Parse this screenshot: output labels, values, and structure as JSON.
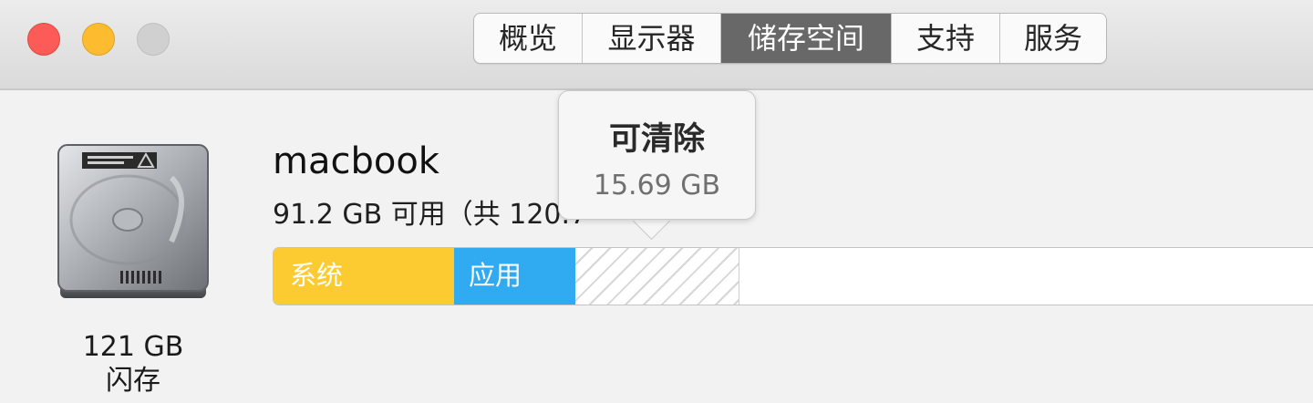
{
  "window": {
    "controls": [
      "close",
      "minimize",
      "zoom"
    ],
    "tabs": [
      {
        "label": "概览",
        "active": false
      },
      {
        "label": "显示器",
        "active": false
      },
      {
        "label": "储存空间",
        "active": true
      },
      {
        "label": "支持",
        "active": false
      },
      {
        "label": "服务",
        "active": false
      }
    ]
  },
  "disk": {
    "icon": "hard-drive-icon",
    "name": "macbook",
    "available": "91.2 GB 可用（共 120.7",
    "capacity": "121 GB",
    "type": "闪存"
  },
  "storage_bar": {
    "segments": [
      {
        "label": "系统",
        "color": "#fccb31"
      },
      {
        "label": "应用",
        "color": "#30aaf0"
      },
      {
        "label": "",
        "color": "#d6d6d6"
      }
    ]
  },
  "tooltip": {
    "title": "可清除",
    "size": "15.69 GB"
  }
}
